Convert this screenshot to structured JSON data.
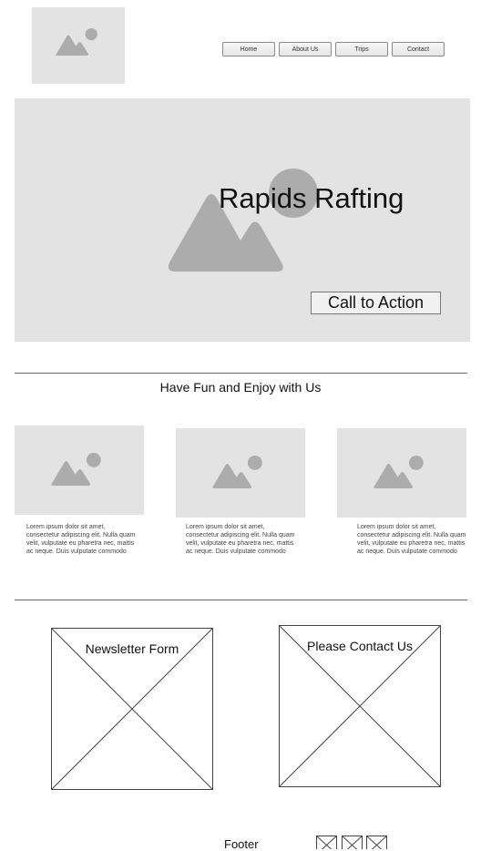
{
  "header": {
    "logo_icon": "image-placeholder-icon",
    "nav": [
      {
        "label": "Home"
      },
      {
        "label": "About Us"
      },
      {
        "label": "Trips"
      },
      {
        "label": "Contact"
      }
    ]
  },
  "hero": {
    "title": "Rapids Rafting",
    "cta_label": "Call to Action"
  },
  "section": {
    "tagline": "Have Fun and Enjoy with Us"
  },
  "cards": [
    {
      "text": "Lorem ipsum dolor sit amet, consectetur adipiscing elit. Nulla quam velit, vulputate eu pharetra nec, mattis ac neque. Duis vulputate commodo"
    },
    {
      "text": "Lorem ipsum dolor sit amet, consectetur adipiscing elit. Nulla quam velit, vulputate eu pharetra nec, mattis ac neque. Duis vulputate commodo"
    },
    {
      "text": "Lorem ipsum dolor sit amet, consectetur adipiscing elit. Nulla quam velit, vulputate eu pharetra nec, mattis ac neque. Duis vulputate commodo"
    }
  ],
  "forms": {
    "newsletter_label": "Newsletter Form",
    "contact_label": "Please Contact Us"
  },
  "footer": {
    "label": "Footer"
  },
  "colors": {
    "placeholder_bg": "#e3e3e3",
    "placeholder_shape": "#acacac"
  }
}
